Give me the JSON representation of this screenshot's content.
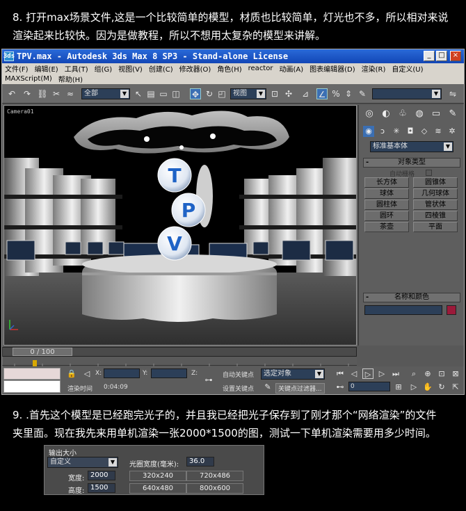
{
  "captions": {
    "step8_line1": "8. 打开max场景文件,这是一个比较简单的模型，材质也比较简单，灯光也不多，所以相对来说",
    "step8_line2": "渲染起来比较快。因为是做教程，所以不想用太复杂的模型来讲解。",
    "step9_line1": "9. .首先这个模型是已经跑完光子的，并且我已经把光子保存到了刚才那个“网络渲染”的文件",
    "step9_line2": "夹里面。现在我先来用单机渲染一张2000*1500的图，测试一下单机渲染需要用多少时间。"
  },
  "window": {
    "app_icon": "3ds",
    "title": "TPV.max - Autodesk 3ds Max 8 SP3  - Stand-alone License",
    "buttons": [
      "_",
      "□",
      "×"
    ]
  },
  "menu": {
    "row1": [
      "文件(F)",
      "编辑(E)",
      "工具(T)",
      "组(G)",
      "视图(V)",
      "创建(C)",
      "修改器(O)",
      "角色(H)",
      "reactor",
      "动画(A)",
      "图表编辑器(D)",
      "渲染(R)",
      "自定义(U)"
    ],
    "row2": [
      "MAXScript(M)",
      "帮助(H)"
    ]
  },
  "toolbar": {
    "selection_filter": "全部",
    "ref_coord": "视图",
    "named_sel": ""
  },
  "viewport": {
    "label": "Camera01",
    "logo_letters": [
      "T",
      "P",
      "V"
    ]
  },
  "command_panel": {
    "category": "标准基本体",
    "object_type_header": "对象类型",
    "autogrid": "自动栅格",
    "primitives": [
      "长方体",
      "圆锥体",
      "球体",
      "几何球体",
      "圆柱体",
      "管状体",
      "圆环",
      "四棱锥",
      "茶壶",
      "平面"
    ],
    "name_color_header": "名称和颜色",
    "color_hex": "#9b1a3a"
  },
  "timeline": {
    "frame_label": "0 / 100"
  },
  "status": {
    "x_label": "X:",
    "y_label": "Y:",
    "z_label": "Z:",
    "render_time_label": "渲染时间",
    "render_time_value": "0:04:09",
    "auto_key": "自动关键点",
    "set_key": "设置关键点",
    "selected_obj": "选定对象",
    "key_filters": "关键点过滤器...",
    "frame_value": "0"
  },
  "render_dialog": {
    "group_title": "输出大小",
    "preset": "自定义",
    "aperture_label": "光圈宽度(毫米):",
    "aperture_value": "36.0",
    "width_label": "宽度:",
    "width_value": "2000",
    "height_label": "高度:",
    "height_value": "1500",
    "presets": [
      "320x240",
      "720x486",
      "640x480",
      "800x600"
    ]
  }
}
